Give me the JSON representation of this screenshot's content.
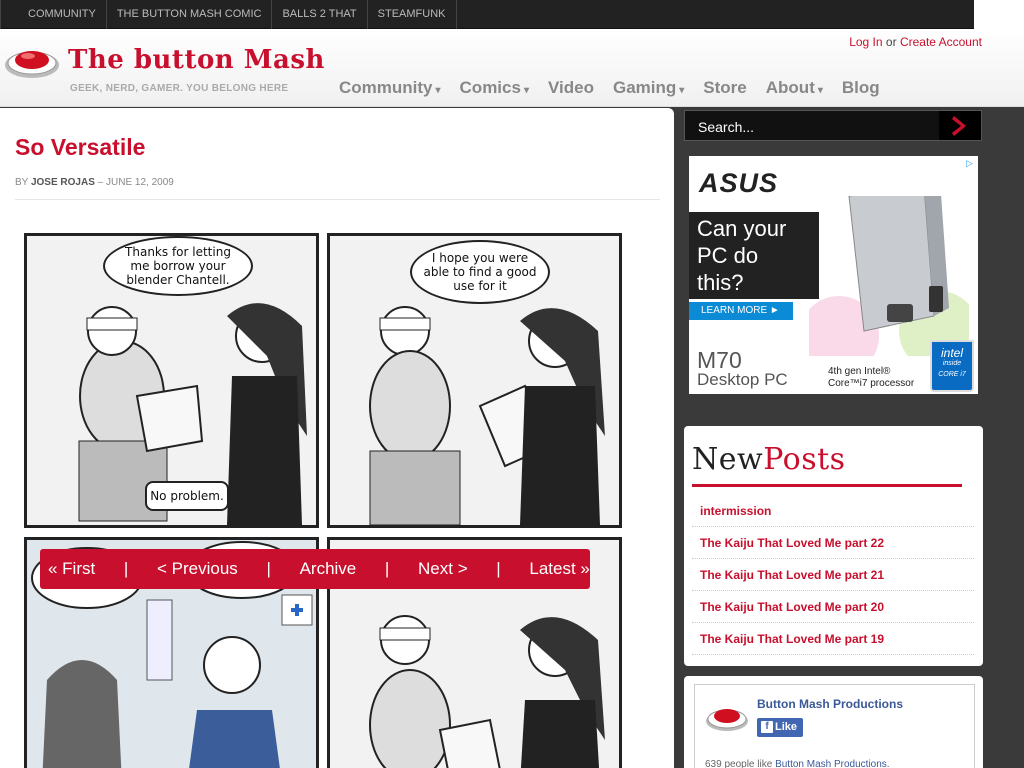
{
  "topbar": {
    "items": [
      "COMMUNITY",
      "THE BUTTON MASH COMIC",
      "BALLS 2 THAT",
      "STEAMFUNK"
    ]
  },
  "header": {
    "logo_text": "The button Mash",
    "tagline": "GEEK, NERD, GAMER. YOU BELONG HERE",
    "login": "Log In",
    "or": "or",
    "create_account": "Create Account",
    "nav": [
      {
        "label": "Community",
        "caret": true
      },
      {
        "label": "Comics",
        "caret": true
      },
      {
        "label": "Video",
        "caret": false
      },
      {
        "label": "Gaming",
        "caret": true
      },
      {
        "label": "Store",
        "caret": false
      },
      {
        "label": "About",
        "caret": true
      },
      {
        "label": "Blog",
        "caret": false
      }
    ]
  },
  "post": {
    "title": "So Versatile",
    "by": "BY",
    "author": "JOSE ROJAS",
    "date_sep": "–",
    "date": "JUNE 12, 2009"
  },
  "comic": {
    "bubbles": {
      "p1_a": "Thanks for letting me borrow your blender Chantell.",
      "p1_b": "No problem.",
      "p2_a": "I hope you were able to find a good use for it"
    },
    "nav": {
      "first": "« First",
      "previous": "<  Previous",
      "archive": "Archive",
      "next": "Next  >",
      "latest": "Latest »",
      "sep": "|"
    }
  },
  "sidebar": {
    "search_placeholder": "Search...",
    "ad": {
      "brand": "ASUS",
      "headline_1": "Can your",
      "headline_2": "PC do",
      "headline_3": "this?",
      "learn_more": "LEARN MORE ►",
      "model": "M70",
      "model_sub": "Desktop PC",
      "fine_1": "4th gen Intel®",
      "fine_2": "Core™i7 processor",
      "intel_1": "intel",
      "intel_2": "inside",
      "intel_3": "CORE i7"
    },
    "new_posts": {
      "title_a": "New",
      "title_b": "Posts",
      "items": [
        "intermission",
        "The Kaiju That Loved Me part 22",
        "The Kaiju That Loved Me part 21",
        "The Kaiju That Loved Me part 20",
        "The Kaiju That Loved Me part 19"
      ]
    },
    "facebook": {
      "page_name": "Button Mash Productions",
      "like": "Like",
      "count_text": "639 people like",
      "count_link": "Button Mash Productions."
    }
  },
  "colors": {
    "accent": "#c8102e",
    "facebook": "#4267b2",
    "dark_bar": "#222222"
  }
}
